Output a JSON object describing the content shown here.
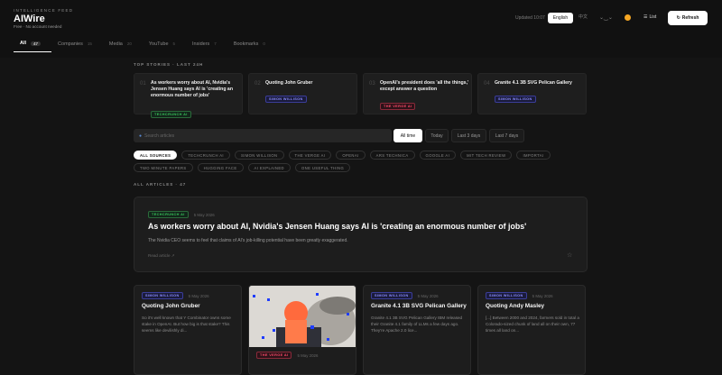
{
  "header": {
    "eyebrow": "INTELLIGENCE FEED",
    "brand": "AIWire",
    "tagline": "Free · No account needed",
    "updated": "Updated 10:07",
    "lang_active": "English",
    "lang_other": "中文",
    "list_label": "List",
    "refresh_label": "Refresh"
  },
  "tabs": [
    {
      "label": "All",
      "count": "47"
    },
    {
      "label": "Companies",
      "count": "15"
    },
    {
      "label": "Media",
      "count": "20"
    },
    {
      "label": "YouTube",
      "count": "5"
    },
    {
      "label": "Insiders",
      "count": "7"
    },
    {
      "label": "Bookmarks",
      "count": "0"
    }
  ],
  "top_stories": {
    "heading": "TOP STORIES · LAST 24H",
    "items": [
      {
        "num": "01",
        "title": "As workers worry about AI, Nvidia's Jensen Huang says AI is 'creating an enormous number of jobs'",
        "source": "TECHCRUNCH AI"
      },
      {
        "num": "02",
        "title": "Quoting John Gruber",
        "source": "SIMON WILLISON"
      },
      {
        "num": "03",
        "title": "OpenAI's president does 'all the things,' except answer a question",
        "source": "THE VERGE AI"
      },
      {
        "num": "04",
        "title": "Granite 4.1 3B SVG Pelican Gallery",
        "source": "SIMON WILLISON"
      }
    ]
  },
  "search": {
    "placeholder": "Search articles"
  },
  "time_filters": [
    "All time",
    "Today",
    "Last 3 days",
    "Last 7 days"
  ],
  "sources": [
    "ALL SOURCES",
    "TECHCRUNCH AI",
    "SIMON WILLISON",
    "THE VERGE AI",
    "OPENAI",
    "ARS TECHNICA",
    "GOOGLE AI",
    "MIT TECH REVIEW",
    "IMPORTAI",
    "TWO MINUTE PAPERS",
    "HUGGING FACE",
    "AI EXPLAINED",
    "ONE USEFUL THING"
  ],
  "all_articles_heading": "ALL ARTICLES · 47",
  "featured": {
    "source": "TECHCRUNCH AI",
    "date": "5 May 2026",
    "title": "As workers worry about AI, Nvidia's Jensen Huang says AI is 'creating an enormous number of jobs'",
    "desc": "The Nvidia CEO seems to feel that claims of AI's job-killing potential have been greatly exaggerated.",
    "read": "Read article ↗"
  },
  "cards": [
    {
      "source": "SIMON WILLISON",
      "date": "5 May 2026",
      "title": "Quoting John Gruber",
      "desc": "So it's well known that Y Combinator owns some stake in OpenAI. But how big is that stake? This seems like devilishly di..."
    },
    {
      "source": "THE VERGE AI",
      "date": "5 May 2026",
      "title": "",
      "desc": ""
    },
    {
      "source": "SIMON WILLISON",
      "date": "5 May 2026",
      "title": "Granite 4.1 3B SVG Pelican Gallery",
      "desc": "Granite 4.1 3B SVG Pelican Gallery IBM released their Granite 4.1 family of LLMs a few days ago. They're Apache 2.0 lice..."
    },
    {
      "source": "SIMON WILLISON",
      "date": "5 May 2026",
      "title": "Quoting Andy Masley",
      "desc": "[...] Between 2000 and 2024, farmers sold in total a Colorado-sized chunk of land all on their own, 77 times all land on..."
    }
  ],
  "colors": {
    "accent": "#ffffff",
    "techcrunch": "#39c25a",
    "simon": "#8b8dff",
    "verge": "#ff4b6a"
  }
}
